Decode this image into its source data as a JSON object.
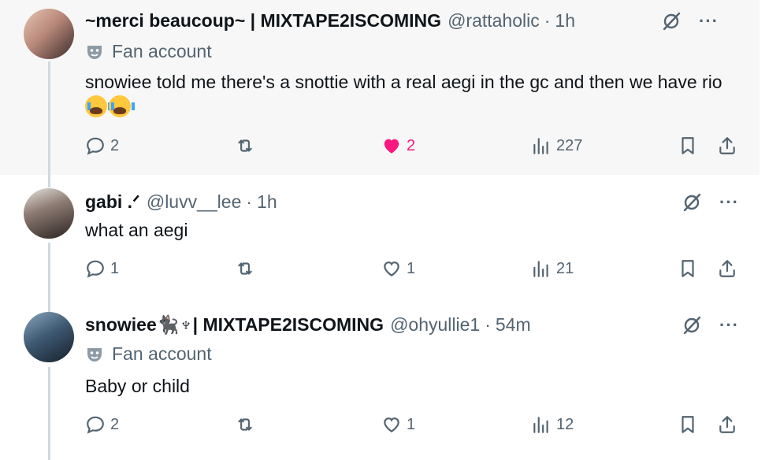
{
  "tweets": [
    {
      "name": "~merci beaucoup~ | MIXTAPE2ISCOMING",
      "handle": "@rattaholic",
      "time": "1h",
      "label": "Fan account",
      "text": "snowiee told me there's a snottie with a real aegi in the gc and then we have rio",
      "emoji": [
        "loudly-crying-face",
        "loudly-crying-face"
      ],
      "replies": "2",
      "retweets": "",
      "likes": "2",
      "liked": true,
      "views": "227"
    },
    {
      "name": "gabi  .ᐟ",
      "handle": "@luvv__lee",
      "time": "1h",
      "text": "what an aegi",
      "replies": "1",
      "retweets": "",
      "likes": "1",
      "liked": false,
      "views": "21"
    },
    {
      "name": "snowiee🐈‍⬛♆| MIXTAPE2ISCOMING",
      "handle": "@ohyullie1",
      "time": "54m",
      "label": "Fan account",
      "text": "Baby or child",
      "replies": "2",
      "retweets": "",
      "likes": "1",
      "liked": false,
      "views": "12"
    }
  ],
  "separator": "·",
  "more_glyph": "···",
  "colors": {
    "like_active": "#f91880",
    "muted": "#536471",
    "thread_line": "#cfd9de"
  },
  "icons": [
    "grok-slash-icon",
    "more-icon",
    "reply-icon",
    "retweet-icon",
    "heart-icon",
    "views-icon",
    "bookmark-icon",
    "share-icon",
    "mask-icon"
  ]
}
